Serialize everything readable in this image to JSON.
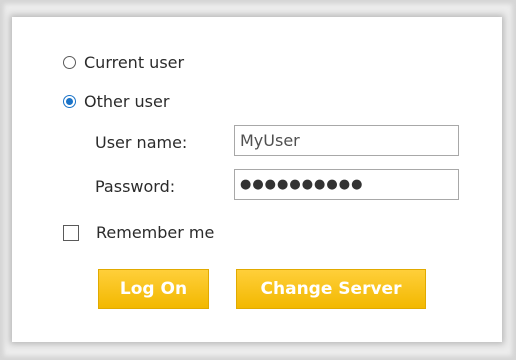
{
  "auth_options": {
    "current_user_label": "Current user",
    "other_user_label": "Other user",
    "selected": "other_user"
  },
  "credentials": {
    "username_label": "User name:",
    "username_value": "MyUser",
    "password_label": "Password:",
    "password_masked": "●●●●●●●●●●"
  },
  "remember": {
    "label": "Remember me",
    "checked": false
  },
  "buttons": {
    "logon_label": "Log On",
    "change_server_label": "Change Server"
  },
  "colors": {
    "radio_selected": "#1a73c8",
    "button_yellow": "#f7bf14",
    "button_text": "#ffffff"
  }
}
